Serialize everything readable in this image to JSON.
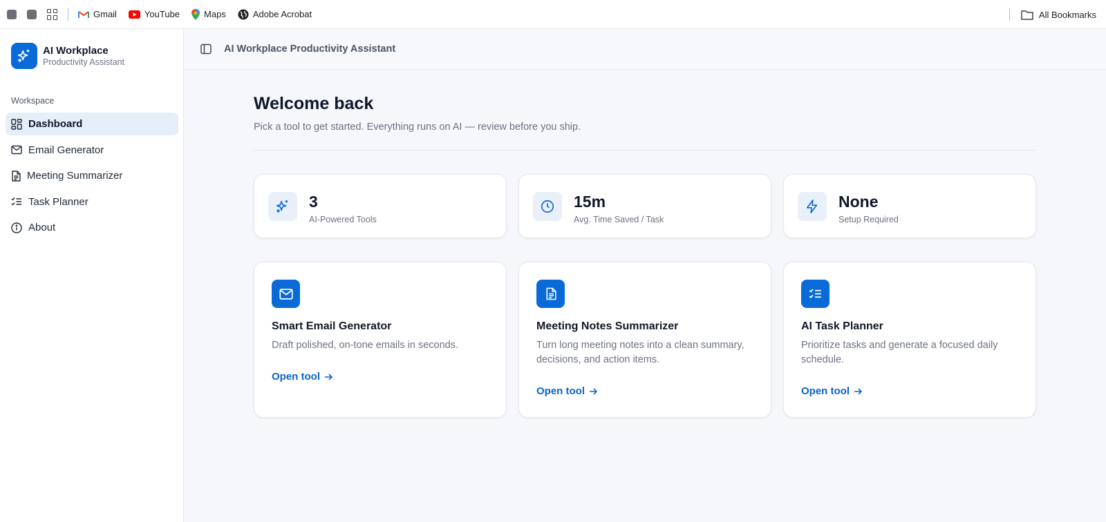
{
  "bookmarks": {
    "items": [
      {
        "label": "Gmail",
        "icon": "gmail-icon"
      },
      {
        "label": "YouTube",
        "icon": "youtube-icon"
      },
      {
        "label": "Maps",
        "icon": "maps-icon"
      },
      {
        "label": "Adobe Acrobat",
        "icon": "globe-icon"
      }
    ],
    "all_bookmarks": "All Bookmarks"
  },
  "sidebar": {
    "brand_title": "AI Workplace",
    "brand_subtitle": "Productivity Assistant",
    "section_label": "Workspace",
    "items": [
      {
        "label": "Dashboard",
        "icon": "dashboard-icon",
        "active": true
      },
      {
        "label": "Email Generator",
        "icon": "mail-icon"
      },
      {
        "label": "Meeting Summarizer",
        "icon": "document-icon"
      },
      {
        "label": "Task Planner",
        "icon": "checklist-icon"
      },
      {
        "label": "About",
        "icon": "info-icon"
      }
    ]
  },
  "header": {
    "title": "AI Workplace Productivity Assistant"
  },
  "main": {
    "welcome": "Welcome back",
    "subtitle": "Pick a tool to get started. Everything runs on AI — review before you ship.",
    "stats": [
      {
        "value": "3",
        "label": "AI-Powered Tools",
        "icon": "sparkles-icon"
      },
      {
        "value": "15m",
        "label": "Avg. Time Saved / Task",
        "icon": "clock-icon"
      },
      {
        "value": "None",
        "label": "Setup Required",
        "icon": "lightning-icon"
      }
    ],
    "tools": [
      {
        "title": "Smart Email Generator",
        "description": "Draft polished, on-tone emails in seconds.",
        "link": "Open tool",
        "icon": "mail-icon"
      },
      {
        "title": "Meeting Notes Summarizer",
        "description": "Turn long meeting notes into a clean summary, decisions, and action items.",
        "link": "Open tool",
        "icon": "document-icon"
      },
      {
        "title": "AI Task Planner",
        "description": "Prioritize tasks and generate a focused daily schedule.",
        "link": "Open tool",
        "icon": "checklist-icon"
      }
    ]
  },
  "colors": {
    "accent": "#0a6ad8",
    "link": "#0a63c9",
    "active_nav_bg": "#e6eef9"
  }
}
